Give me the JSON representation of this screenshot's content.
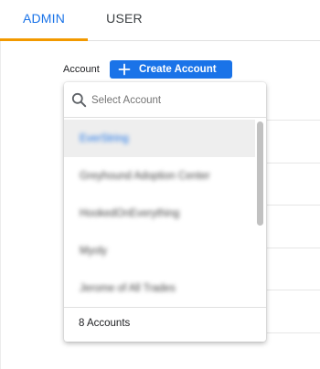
{
  "tabs": [
    {
      "label": "ADMIN",
      "active": true
    },
    {
      "label": "USER",
      "active": false
    }
  ],
  "account_picker": {
    "label": "Account",
    "create_button": "Create Account",
    "search_placeholder": "Select Account",
    "items": [
      {
        "label": "EverString",
        "selected": true
      },
      {
        "label": "Greyhound Adoption Center",
        "selected": false
      },
      {
        "label": "HookedOnEverything",
        "selected": false
      },
      {
        "label": "Myoly",
        "selected": false
      },
      {
        "label": "Jerome of All Trades",
        "selected": false
      }
    ],
    "count_label": "8 Accounts"
  },
  "colors": {
    "accent": "#1a73e8",
    "tab_indicator": "#f29900"
  },
  "icons": {
    "create": "plus-icon",
    "search": "search-icon"
  }
}
